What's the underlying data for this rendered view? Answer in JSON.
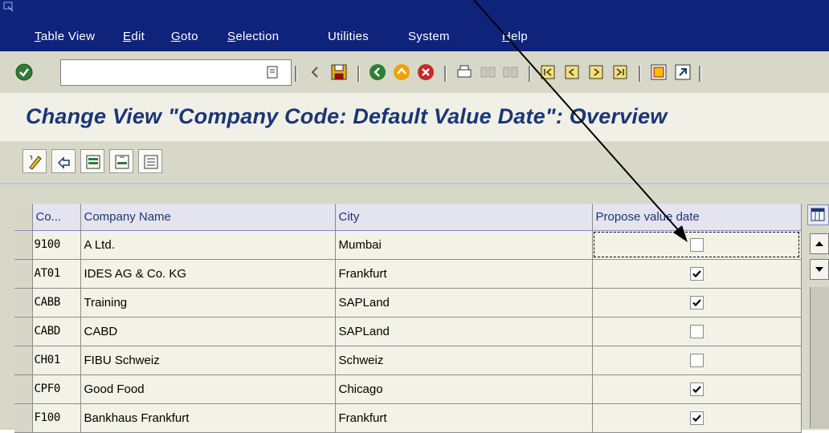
{
  "menu": {
    "items": [
      "Table View",
      "Edit",
      "Goto",
      "Selection",
      "Utilities",
      "System",
      "Help"
    ],
    "mnemonics": [
      "T",
      "E",
      "G",
      "S",
      "",
      "",
      "H"
    ]
  },
  "toolbar": {
    "command_field_value": "",
    "icons": [
      "enter-icon",
      "history-icon",
      "back-arrow-icon",
      "save-icon",
      "back-icon",
      "exit-icon",
      "cancel-icon",
      "print-icon",
      "find-icon",
      "find-next-icon",
      "first-page-icon",
      "previous-page-icon",
      "next-page-icon",
      "last-page-icon",
      "create-session-icon",
      "shortcut-icon"
    ]
  },
  "page": {
    "title": "Change View \"Company Code: Default Value Date\": Overview"
  },
  "app_toolbar": {
    "icons": [
      "edit-pencil-icon",
      "undo-icon",
      "select-all-icon",
      "select-block-icon",
      "deselect-all-icon"
    ]
  },
  "table": {
    "columns": [
      "Co...",
      "Company Name",
      "City",
      "Propose value date"
    ],
    "rows": [
      {
        "code": "9100",
        "name": "A Ltd.",
        "city": "Mumbai",
        "propose": false
      },
      {
        "code": "AT01",
        "name": "IDES AG & Co. KG",
        "city": "Frankfurt",
        "propose": true
      },
      {
        "code": "CABB",
        "name": "Training",
        "city": "SAPLand",
        "propose": true
      },
      {
        "code": "CABD",
        "name": "CABD",
        "city": "SAPLand",
        "propose": false
      },
      {
        "code": "CH01",
        "name": "FIBU Schweiz",
        "city": "Schweiz",
        "propose": false
      },
      {
        "code": "CPF0",
        "name": "Good Food",
        "city": "Chicago",
        "propose": true
      },
      {
        "code": "F100",
        "name": "Bankhaus Frankfurt",
        "city": "Frankfurt",
        "propose": true
      }
    ]
  },
  "colors": {
    "menubar": "#10237b",
    "title_text": "#1c3575",
    "toolbar_bg": "#d8d8c8"
  }
}
